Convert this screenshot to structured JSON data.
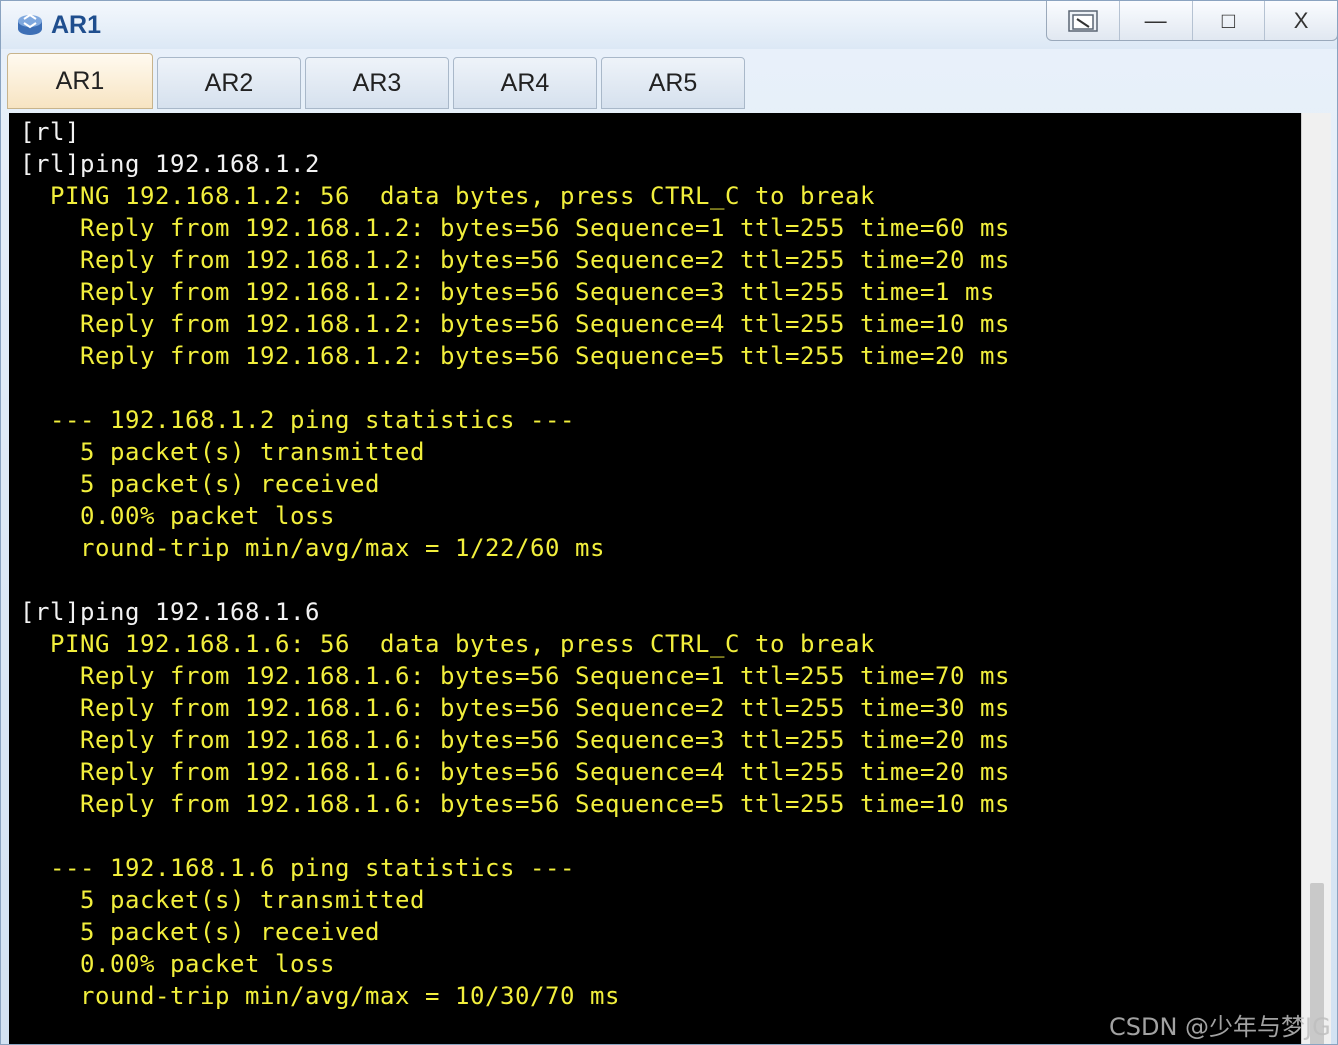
{
  "window": {
    "title": "AR1",
    "icon": "router-icon",
    "controls": {
      "restore_icon": "restore-window-icon",
      "minimize_label": "—",
      "maximize_label": "□",
      "close_label": "X"
    }
  },
  "tabs": [
    {
      "label": "AR1",
      "active": true
    },
    {
      "label": "AR2",
      "active": false
    },
    {
      "label": "AR3",
      "active": false
    },
    {
      "label": "AR4",
      "active": false
    },
    {
      "label": "AR5",
      "active": false
    }
  ],
  "terminal": {
    "lines": [
      "[rl]",
      "[rl]ping 192.168.1.2",
      "  PING 192.168.1.2: 56  data bytes, press CTRL_C to break",
      "    Reply from 192.168.1.2: bytes=56 Sequence=1 ttl=255 time=60 ms",
      "    Reply from 192.168.1.2: bytes=56 Sequence=2 ttl=255 time=20 ms",
      "    Reply from 192.168.1.2: bytes=56 Sequence=3 ttl=255 time=1 ms",
      "    Reply from 192.168.1.2: bytes=56 Sequence=4 ttl=255 time=10 ms",
      "    Reply from 192.168.1.2: bytes=56 Sequence=5 ttl=255 time=20 ms",
      "",
      "  --- 192.168.1.2 ping statistics ---",
      "    5 packet(s) transmitted",
      "    5 packet(s) received",
      "    0.00% packet loss",
      "    round-trip min/avg/max = 1/22/60 ms",
      "",
      "[rl]ping 192.168.1.6",
      "  PING 192.168.1.6: 56  data bytes, press CTRL_C to break",
      "    Reply from 192.168.1.6: bytes=56 Sequence=1 ttl=255 time=70 ms",
      "    Reply from 192.168.1.6: bytes=56 Sequence=2 ttl=255 time=30 ms",
      "    Reply from 192.168.1.6: bytes=56 Sequence=3 ttl=255 time=20 ms",
      "    Reply from 192.168.1.6: bytes=56 Sequence=4 ttl=255 time=20 ms",
      "    Reply from 192.168.1.6: bytes=56 Sequence=5 ttl=255 time=10 ms",
      "",
      "  --- 192.168.1.6 ping statistics ---",
      "    5 packet(s) transmitted",
      "    5 packet(s) received",
      "    0.00% packet loss",
      "    round-trip min/avg/max = 10/30/70 ms"
    ],
    "text_color": "#f2ef3c",
    "background_color": "#000000"
  },
  "watermark": "CSDN @少年与梦JG"
}
